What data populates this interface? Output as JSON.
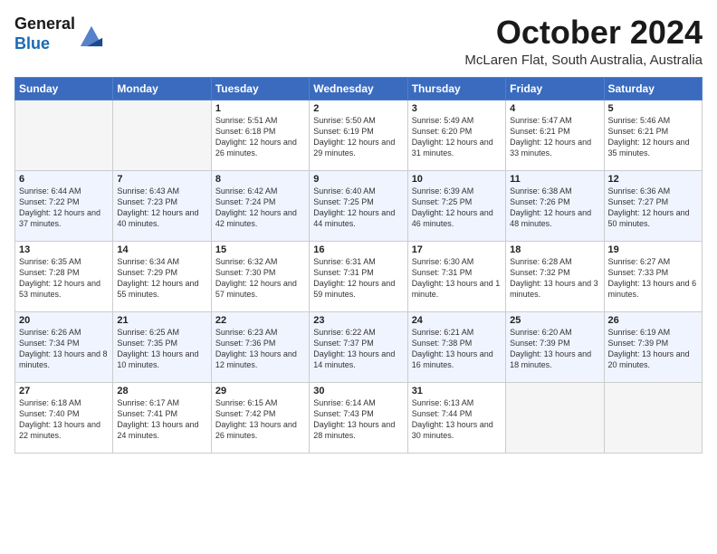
{
  "logo": {
    "line1": "General",
    "line2": "Blue"
  },
  "header": {
    "title": "October 2024",
    "subtitle": "McLaren Flat, South Australia, Australia"
  },
  "days_of_week": [
    "Sunday",
    "Monday",
    "Tuesday",
    "Wednesday",
    "Thursday",
    "Friday",
    "Saturday"
  ],
  "weeks": [
    [
      {
        "day": "",
        "empty": true
      },
      {
        "day": "",
        "empty": true
      },
      {
        "day": "1",
        "sunrise": "Sunrise: 5:51 AM",
        "sunset": "Sunset: 6:18 PM",
        "daylight": "Daylight: 12 hours and 26 minutes."
      },
      {
        "day": "2",
        "sunrise": "Sunrise: 5:50 AM",
        "sunset": "Sunset: 6:19 PM",
        "daylight": "Daylight: 12 hours and 29 minutes."
      },
      {
        "day": "3",
        "sunrise": "Sunrise: 5:49 AM",
        "sunset": "Sunset: 6:20 PM",
        "daylight": "Daylight: 12 hours and 31 minutes."
      },
      {
        "day": "4",
        "sunrise": "Sunrise: 5:47 AM",
        "sunset": "Sunset: 6:21 PM",
        "daylight": "Daylight: 12 hours and 33 minutes."
      },
      {
        "day": "5",
        "sunrise": "Sunrise: 5:46 AM",
        "sunset": "Sunset: 6:21 PM",
        "daylight": "Daylight: 12 hours and 35 minutes."
      }
    ],
    [
      {
        "day": "6",
        "sunrise": "Sunrise: 6:44 AM",
        "sunset": "Sunset: 7:22 PM",
        "daylight": "Daylight: 12 hours and 37 minutes."
      },
      {
        "day": "7",
        "sunrise": "Sunrise: 6:43 AM",
        "sunset": "Sunset: 7:23 PM",
        "daylight": "Daylight: 12 hours and 40 minutes."
      },
      {
        "day": "8",
        "sunrise": "Sunrise: 6:42 AM",
        "sunset": "Sunset: 7:24 PM",
        "daylight": "Daylight: 12 hours and 42 minutes."
      },
      {
        "day": "9",
        "sunrise": "Sunrise: 6:40 AM",
        "sunset": "Sunset: 7:25 PM",
        "daylight": "Daylight: 12 hours and 44 minutes."
      },
      {
        "day": "10",
        "sunrise": "Sunrise: 6:39 AM",
        "sunset": "Sunset: 7:25 PM",
        "daylight": "Daylight: 12 hours and 46 minutes."
      },
      {
        "day": "11",
        "sunrise": "Sunrise: 6:38 AM",
        "sunset": "Sunset: 7:26 PM",
        "daylight": "Daylight: 12 hours and 48 minutes."
      },
      {
        "day": "12",
        "sunrise": "Sunrise: 6:36 AM",
        "sunset": "Sunset: 7:27 PM",
        "daylight": "Daylight: 12 hours and 50 minutes."
      }
    ],
    [
      {
        "day": "13",
        "sunrise": "Sunrise: 6:35 AM",
        "sunset": "Sunset: 7:28 PM",
        "daylight": "Daylight: 12 hours and 53 minutes."
      },
      {
        "day": "14",
        "sunrise": "Sunrise: 6:34 AM",
        "sunset": "Sunset: 7:29 PM",
        "daylight": "Daylight: 12 hours and 55 minutes."
      },
      {
        "day": "15",
        "sunrise": "Sunrise: 6:32 AM",
        "sunset": "Sunset: 7:30 PM",
        "daylight": "Daylight: 12 hours and 57 minutes."
      },
      {
        "day": "16",
        "sunrise": "Sunrise: 6:31 AM",
        "sunset": "Sunset: 7:31 PM",
        "daylight": "Daylight: 12 hours and 59 minutes."
      },
      {
        "day": "17",
        "sunrise": "Sunrise: 6:30 AM",
        "sunset": "Sunset: 7:31 PM",
        "daylight": "Daylight: 13 hours and 1 minute."
      },
      {
        "day": "18",
        "sunrise": "Sunrise: 6:28 AM",
        "sunset": "Sunset: 7:32 PM",
        "daylight": "Daylight: 13 hours and 3 minutes."
      },
      {
        "day": "19",
        "sunrise": "Sunrise: 6:27 AM",
        "sunset": "Sunset: 7:33 PM",
        "daylight": "Daylight: 13 hours and 6 minutes."
      }
    ],
    [
      {
        "day": "20",
        "sunrise": "Sunrise: 6:26 AM",
        "sunset": "Sunset: 7:34 PM",
        "daylight": "Daylight: 13 hours and 8 minutes."
      },
      {
        "day": "21",
        "sunrise": "Sunrise: 6:25 AM",
        "sunset": "Sunset: 7:35 PM",
        "daylight": "Daylight: 13 hours and 10 minutes."
      },
      {
        "day": "22",
        "sunrise": "Sunrise: 6:23 AM",
        "sunset": "Sunset: 7:36 PM",
        "daylight": "Daylight: 13 hours and 12 minutes."
      },
      {
        "day": "23",
        "sunrise": "Sunrise: 6:22 AM",
        "sunset": "Sunset: 7:37 PM",
        "daylight": "Daylight: 13 hours and 14 minutes."
      },
      {
        "day": "24",
        "sunrise": "Sunrise: 6:21 AM",
        "sunset": "Sunset: 7:38 PM",
        "daylight": "Daylight: 13 hours and 16 minutes."
      },
      {
        "day": "25",
        "sunrise": "Sunrise: 6:20 AM",
        "sunset": "Sunset: 7:39 PM",
        "daylight": "Daylight: 13 hours and 18 minutes."
      },
      {
        "day": "26",
        "sunrise": "Sunrise: 6:19 AM",
        "sunset": "Sunset: 7:39 PM",
        "daylight": "Daylight: 13 hours and 20 minutes."
      }
    ],
    [
      {
        "day": "27",
        "sunrise": "Sunrise: 6:18 AM",
        "sunset": "Sunset: 7:40 PM",
        "daylight": "Daylight: 13 hours and 22 minutes."
      },
      {
        "day": "28",
        "sunrise": "Sunrise: 6:17 AM",
        "sunset": "Sunset: 7:41 PM",
        "daylight": "Daylight: 13 hours and 24 minutes."
      },
      {
        "day": "29",
        "sunrise": "Sunrise: 6:15 AM",
        "sunset": "Sunset: 7:42 PM",
        "daylight": "Daylight: 13 hours and 26 minutes."
      },
      {
        "day": "30",
        "sunrise": "Sunrise: 6:14 AM",
        "sunset": "Sunset: 7:43 PM",
        "daylight": "Daylight: 13 hours and 28 minutes."
      },
      {
        "day": "31",
        "sunrise": "Sunrise: 6:13 AM",
        "sunset": "Sunset: 7:44 PM",
        "daylight": "Daylight: 13 hours and 30 minutes."
      },
      {
        "day": "",
        "empty": true
      },
      {
        "day": "",
        "empty": true
      }
    ]
  ]
}
